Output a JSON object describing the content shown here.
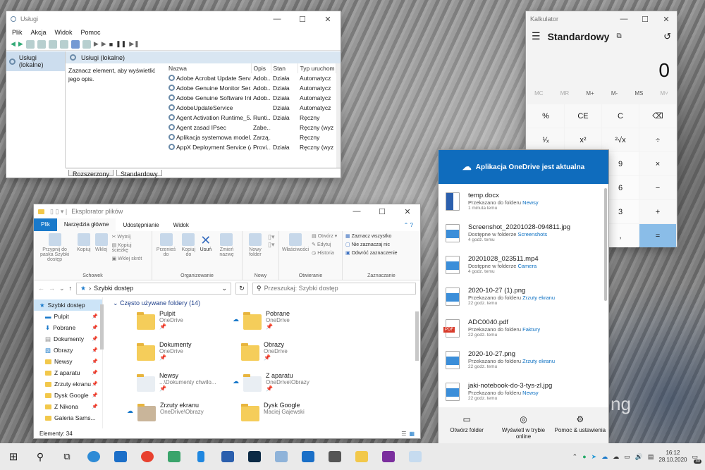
{
  "services": {
    "title": "Usługi",
    "menu": [
      "Plik",
      "Akcja",
      "Widok",
      "Pomoc"
    ],
    "tree_item": "Usługi (lokalne)",
    "header": "Usługi (lokalne)",
    "description": "Zaznacz element, aby wyświetlić jego opis.",
    "columns": [
      "Nazwa",
      "Opis",
      "Stan",
      "Typ uruchom"
    ],
    "rows": [
      [
        "Adobe Acrobat Update Servi...",
        "Adob...",
        "Działa",
        "Automatycz"
      ],
      [
        "Adobe Genuine Monitor Ser...",
        "Adob...",
        "Działa",
        "Automatycz"
      ],
      [
        "Adobe Genuine Software Int...",
        "Adob...",
        "Działa",
        "Automatycz"
      ],
      [
        "AdobeUpdateService",
        "",
        "Działa",
        "Automatycz"
      ],
      [
        "Agent Activation Runtime_5...",
        "Runti...",
        "Działa",
        "Ręczny"
      ],
      [
        "Agent zasad IPsec",
        "Zabe...",
        "",
        "Ręczny (wyz"
      ],
      [
        "Aplikacja systemowa model...",
        "Zarzą...",
        "",
        "Ręczny"
      ],
      [
        "AppX Deployment Service (A...",
        "Provi...",
        "Działa",
        "Ręczny (wyz"
      ]
    ],
    "tabs": [
      "Rozszerzony",
      "Standardowy"
    ]
  },
  "explorer": {
    "title": "Eksplorator plików",
    "ribbon_tabs": [
      "Plik",
      "Narzędzia główne",
      "Udostępnianie",
      "Widok"
    ],
    "groups": {
      "schowek": {
        "caption": "Schowek",
        "pin": "Przypnij do paska Szybki dostęp",
        "copy": "Kopiuj",
        "paste": "Wklej",
        "cut": "Wytnij",
        "copy_path": "Kopiuj ścieżkę",
        "paste_shortcut": "Wklej skrót"
      },
      "organizowanie": {
        "caption": "Organizowanie",
        "move": "Przenieś do",
        "copyto": "Kopiuj do",
        "delete": "Usuń",
        "rename": "Zmień nazwę"
      },
      "nowy": {
        "caption": "Nowy",
        "new_folder": "Nowy folder"
      },
      "otwieranie": {
        "caption": "Otwieranie",
        "properties": "Właściwości",
        "open": "Otwórz",
        "edit": "Edytuj",
        "history": "Historia"
      },
      "zaznaczanie": {
        "caption": "Zaznaczanie",
        "select_all": "Zaznacz wszystko",
        "select_none": "Nie zaznaczaj nic",
        "invert": "Odwróć zaznaczenie"
      }
    },
    "address": "Szybki dostęp",
    "search_placeholder": "Przeszukaj: Szybki dostęp",
    "nav": [
      "Szybki dostęp",
      "Pulpit",
      "Pobrane",
      "Dokumenty",
      "Obrazy",
      "Newsy",
      "Z aparatu",
      "Zrzuty ekranu",
      "Dysk Google",
      "Z Nikona",
      "Galeria Sams..."
    ],
    "section": "Często używane foldery (14)",
    "folders": [
      {
        "name": "Pulpit",
        "sub": "OneDrive"
      },
      {
        "name": "Pobrane",
        "sub": "OneDrive"
      },
      {
        "name": "Dokumenty",
        "sub": "OneDrive"
      },
      {
        "name": "Obrazy",
        "sub": "OneDrive"
      },
      {
        "name": "Newsy",
        "sub": "...\\Dokumenty chwilo..."
      },
      {
        "name": "Z aparatu",
        "sub": "OneDrive\\Obrazy"
      },
      {
        "name": "Zrzuty ekranu",
        "sub": "OneDrive\\Obrazy"
      },
      {
        "name": "Dysk Google",
        "sub": "Maciej Gajewski"
      }
    ],
    "status": "Elementy: 34"
  },
  "calc": {
    "title": "Kalkulator",
    "mode": "Standardowy",
    "display": "0",
    "memory": [
      "MC",
      "MR",
      "M+",
      "M-",
      "MS",
      "M˅"
    ],
    "rows": [
      [
        "%",
        "CE",
        "C",
        "⌫"
      ],
      [
        "¹⁄ₓ",
        "x²",
        "²√x",
        "÷"
      ],
      [
        "",
        "",
        "9",
        "×"
      ],
      [
        "",
        "",
        "6",
        "−"
      ],
      [
        "",
        "",
        "3",
        "+"
      ],
      [
        "",
        "",
        ",",
        "="
      ]
    ]
  },
  "onedrive": {
    "header": "Aplikacja OneDrive jest aktualna",
    "items": [
      {
        "name": "temp.docx",
        "sub": "Przekazano do folderu",
        "folder": "Newsy",
        "time": "1 minuta temu",
        "icon": "word"
      },
      {
        "name": "Screenshot_20201028-094811.jpg",
        "sub": "Dostępne w folderze",
        "folder": "Screenshots",
        "time": "4 godz. temu",
        "icon": "image"
      },
      {
        "name": "20201028_023511.mp4",
        "sub": "Dostępne w folderze",
        "folder": "Camera",
        "time": "4 godz. temu",
        "icon": "video"
      },
      {
        "name": "2020-10-27 (1).png",
        "sub": "Przekazano do folderu",
        "folder": "Zrzuty ekranu",
        "time": "22 godz. temu",
        "icon": "image"
      },
      {
        "name": "ADC0040.pdf",
        "sub": "Przekazano do folderu",
        "folder": "Faktury",
        "time": "22 godz. temu",
        "icon": "pdf"
      },
      {
        "name": "2020-10-27.png",
        "sub": "Przekazano do folderu",
        "folder": "Zrzuty ekranu",
        "time": "22 godz. temu",
        "icon": "image"
      },
      {
        "name": "jaki-notebook-do-3-tys-zl.jpg",
        "sub": "Przekazano do folderu",
        "folder": "Newsy",
        "time": "22 godz. temu",
        "icon": "image"
      }
    ],
    "footer": [
      "Otwórz folder",
      "Wyświetl w trybie online",
      "Pomoc & ustawienia"
    ],
    "pdf_label": "PDF"
  },
  "desktop": {
    "watermark": "ng"
  },
  "taskbar": {
    "time": "16:12",
    "date": "28.10.2020",
    "badge": "30"
  }
}
